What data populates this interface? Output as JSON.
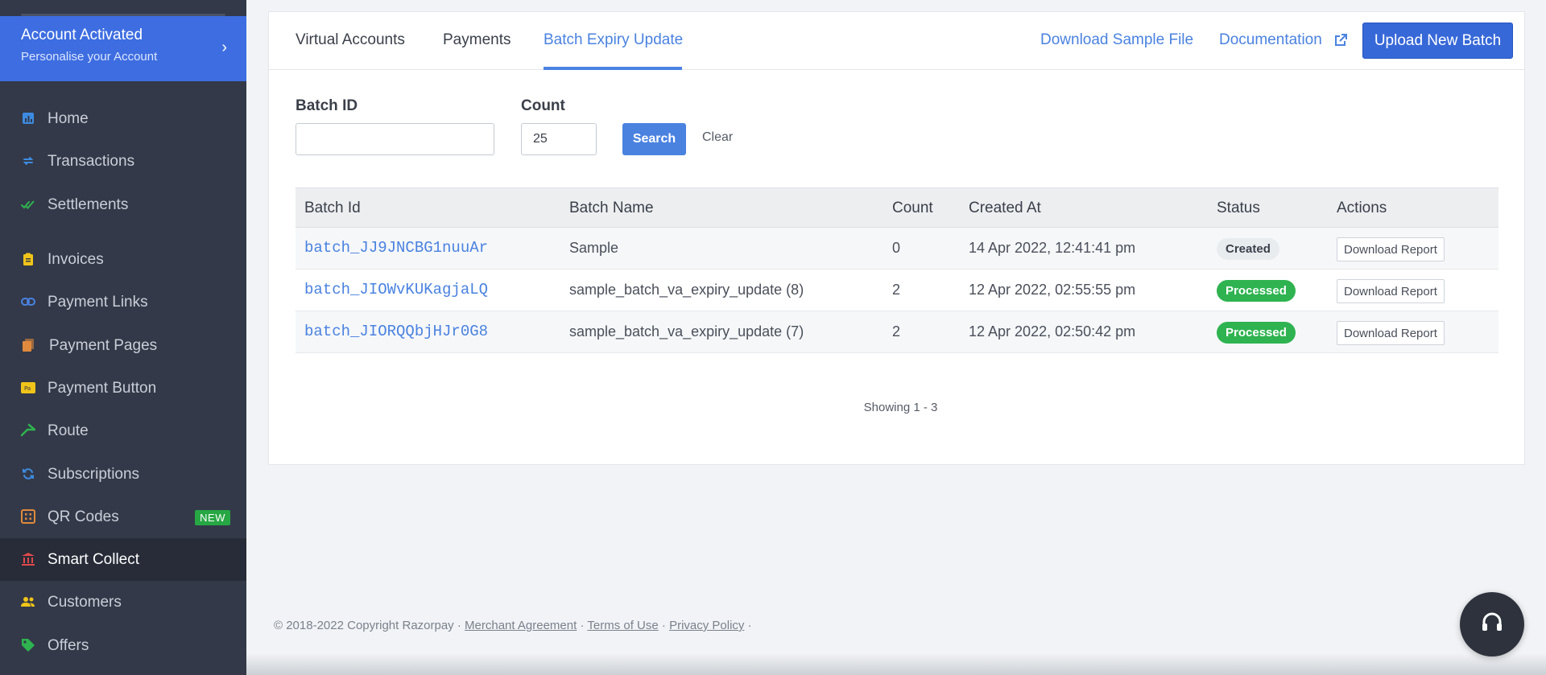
{
  "sidebar": {
    "account": {
      "title": "Account Activated",
      "subtitle": "Personalise your Account"
    },
    "items": [
      {
        "label": "Home",
        "icon": "bar-chart-icon",
        "color": "#3d8be0"
      },
      {
        "label": "Transactions",
        "icon": "swap-icon",
        "color": "#3d8be0"
      },
      {
        "label": "Settlements",
        "icon": "double-check-icon",
        "color": "#2eb350"
      },
      {
        "label": "Invoices",
        "icon": "clipboard-icon",
        "color": "#f0c419"
      },
      {
        "label": "Payment Links",
        "icon": "link-icon",
        "color": "#4a82e0"
      },
      {
        "label": "Payment Pages",
        "icon": "pages-icon",
        "color": "#e08a3d"
      },
      {
        "label": "Payment Button",
        "icon": "pay-button-icon",
        "color": "#f0c419"
      },
      {
        "label": "Route",
        "icon": "route-icon",
        "color": "#2eb350"
      },
      {
        "label": "Subscriptions",
        "icon": "refresh-icon",
        "color": "#3d8be0"
      },
      {
        "label": "QR Codes",
        "icon": "qr-code-icon",
        "color": "#e08a3d",
        "badge": "NEW"
      },
      {
        "label": "Smart Collect",
        "icon": "bank-icon",
        "color": "#e04a4a"
      },
      {
        "label": "Customers",
        "icon": "users-icon",
        "color": "#f0c419"
      },
      {
        "label": "Offers",
        "icon": "tag-icon",
        "color": "#2eb350"
      }
    ]
  },
  "tabs": [
    "Virtual Accounts",
    "Payments",
    "Batch Expiry Update"
  ],
  "header_links": {
    "download_sample": "Download Sample File",
    "documentation": "Documentation",
    "upload": "Upload New Batch"
  },
  "filters": {
    "batch_id_label": "Batch ID",
    "batch_id_value": "",
    "count_label": "Count",
    "count_value": "25",
    "search": "Search",
    "clear": "Clear"
  },
  "table": {
    "columns": [
      "Batch Id",
      "Batch Name",
      "Count",
      "Created At",
      "Status",
      "Actions"
    ],
    "rows": [
      {
        "id": "batch_JJ9JNCBG1nuuAr",
        "name": "Sample",
        "count": "0",
        "created": "14 Apr 2022, 12:41:41 pm",
        "status": "Created",
        "action": "Download Report"
      },
      {
        "id": "batch_JIOWvKUKagjaLQ",
        "name": "sample_batch_va_expiry_update (8)",
        "count": "2",
        "created": "12 Apr 2022, 02:55:55 pm",
        "status": "Processed",
        "action": "Download Report"
      },
      {
        "id": "batch_JIORQQbjHJr0G8",
        "name": "sample_batch_va_expiry_update (7)",
        "count": "2",
        "created": "12 Apr 2022, 02:50:42 pm",
        "status": "Processed",
        "action": "Download Report"
      }
    ]
  },
  "pagination": "Showing 1 - 3",
  "footer": {
    "copyright": "© 2018-2022 Copyright Razorpay ·",
    "merchant": "Merchant Agreement",
    "terms": "Terms of Use",
    "privacy": "Privacy Policy",
    "sep": "·"
  },
  "colors": {
    "accent": "#4a82e0",
    "primary_button": "#3768d8",
    "sidebar_bg": "#333948",
    "processed": "#2eb350"
  }
}
